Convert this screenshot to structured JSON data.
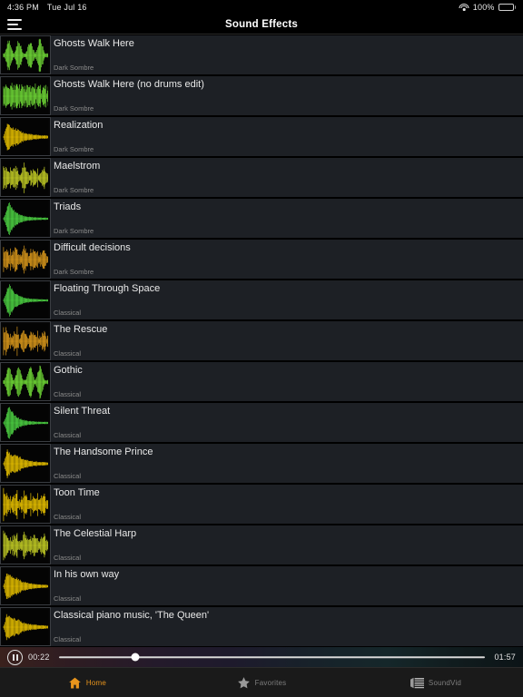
{
  "status_bar": {
    "time": "4:36 PM",
    "date": "Tue Jul 16",
    "battery_percent": "100%",
    "wifi_icon": "wifi-icon",
    "battery_icon": "battery-full-icon"
  },
  "nav": {
    "menu_icon": "hamburger-menu-icon",
    "title": "Sound Effects"
  },
  "colors": {
    "accent": "#e8941c",
    "row_bg": "#1d2025",
    "page_bg": "#000000",
    "title_text": "#e9e9e9",
    "sub_text": "#8c8c8c",
    "waveform_green": "#7cf03c",
    "waveform_yellow": "#ffd400",
    "waveform_orange": "#f0a81e"
  },
  "list": {
    "items": [
      {
        "title": "Ghosts Walk Here",
        "subtitle": "Dark Sombre",
        "waveform_color": "#7cf03c",
        "waveform_style": "bursts"
      },
      {
        "title": "Ghosts Walk Here (no drums edit)",
        "subtitle": "Dark Sombre",
        "waveform_color": "#7cf03c",
        "waveform_style": "spikes"
      },
      {
        "title": "Realization",
        "subtitle": "Dark Sombre",
        "waveform_color": "#ffd400",
        "waveform_style": "decay"
      },
      {
        "title": "Maelstrom",
        "subtitle": "Dark Sombre",
        "waveform_color": "#d8e32a",
        "waveform_style": "dense"
      },
      {
        "title": "Triads",
        "subtitle": "Dark Sombre",
        "waveform_color": "#55e84a",
        "waveform_style": "attack"
      },
      {
        "title": "Difficult decisions",
        "subtitle": "Dark Sombre",
        "waveform_color": "#f0a81e",
        "waveform_style": "dense"
      },
      {
        "title": "Floating Through Space",
        "subtitle": "Classical",
        "waveform_color": "#55e84a",
        "waveform_style": "attack"
      },
      {
        "title": "The Rescue",
        "subtitle": "Classical",
        "waveform_color": "#f0a81e",
        "waveform_style": "dense"
      },
      {
        "title": "Gothic",
        "subtitle": "Classical",
        "waveform_color": "#7cf03c",
        "waveform_style": "bursts"
      },
      {
        "title": "Silent Threat",
        "subtitle": "Classical",
        "waveform_color": "#55e84a",
        "waveform_style": "attack"
      },
      {
        "title": "The Handsome Prince",
        "subtitle": "Classical",
        "waveform_color": "#ffd400",
        "waveform_style": "decay"
      },
      {
        "title": "Toon Time",
        "subtitle": "Classical",
        "waveform_color": "#ffd400",
        "waveform_style": "dense"
      },
      {
        "title": "The Celestial Harp",
        "subtitle": "Classical",
        "waveform_color": "#d8e32a",
        "waveform_style": "dense"
      },
      {
        "title": "In his own way",
        "subtitle": "Classical",
        "waveform_color": "#ffd400",
        "waveform_style": "decay"
      },
      {
        "title": "Classical piano music, 'The Queen'",
        "subtitle": "Classical",
        "waveform_color": "#ffd400",
        "waveform_style": "decay"
      }
    ]
  },
  "player": {
    "state_icon": "pause-icon",
    "elapsed": "00:22",
    "duration": "01:57",
    "progress_percent": 18
  },
  "tabs": [
    {
      "label": "Home",
      "icon": "home-icon",
      "active": true
    },
    {
      "label": "Favorites",
      "icon": "star-icon",
      "active": false
    },
    {
      "label": "SoundVid",
      "icon": "soundvid-icon",
      "active": false
    }
  ]
}
